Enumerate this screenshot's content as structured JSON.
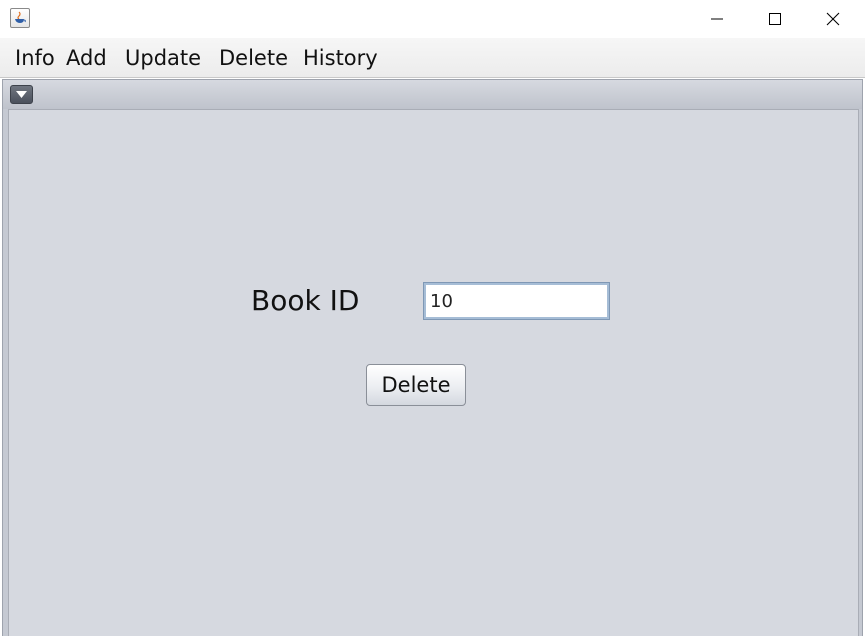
{
  "window": {
    "icons": {
      "app": "java-coffee-cup-icon",
      "minimize": "minimize-icon",
      "maximize": "maximize-icon",
      "close": "close-icon"
    }
  },
  "menubar": {
    "items": [
      {
        "label": "Info"
      },
      {
        "label": "Add"
      },
      {
        "label": "Update"
      },
      {
        "label": "Delete"
      },
      {
        "label": "History"
      }
    ]
  },
  "internal_frame": {
    "system_menu_icon": "triangle-down-icon"
  },
  "form": {
    "book_id_label": "Book ID",
    "book_id_value": "10",
    "delete_button_label": "Delete"
  },
  "colors": {
    "content_background": "#d6d9e0",
    "frame_border": "#c5c9d2",
    "input_focus_border": "#a6bdd6"
  }
}
